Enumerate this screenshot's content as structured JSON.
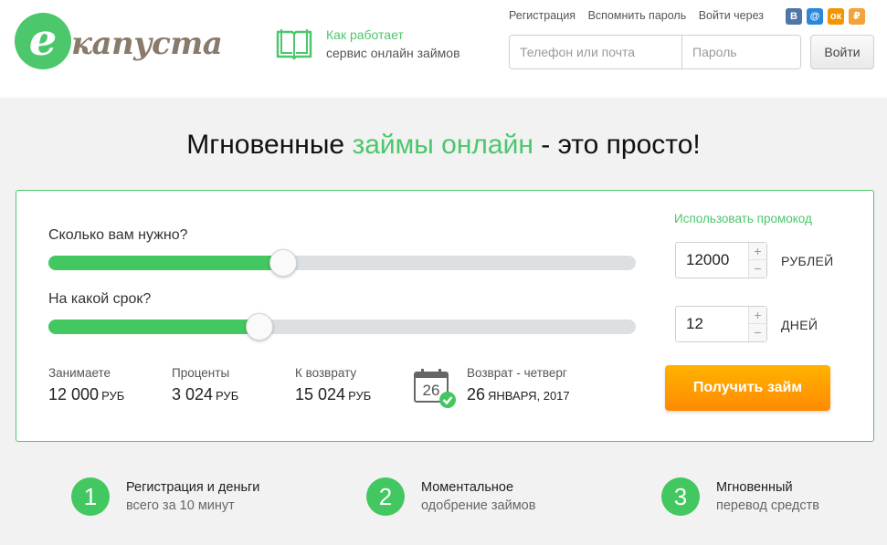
{
  "header": {
    "logo_letter": "e",
    "logo_text": "капуста",
    "how_line1": "Как работает",
    "how_line2": "сервис онлайн займов",
    "links": {
      "register": "Регистрация",
      "recover": "Вспомнить пароль",
      "login_via": "Войти через"
    },
    "social": [
      {
        "name": "vk-icon",
        "glyph": "В",
        "color": "#4f76a6"
      },
      {
        "name": "mailru-icon",
        "glyph": "@",
        "color": "#2b88d8"
      },
      {
        "name": "odnoklassniki-icon",
        "glyph": "ок",
        "color": "#f29500"
      },
      {
        "name": "yandex-money-icon",
        "glyph": "₽",
        "color": "#f2a33a"
      }
    ],
    "phone_placeholder": "Телефон или почта",
    "password_placeholder": "Пароль",
    "login_button": "Войти"
  },
  "headline": {
    "part1": "Мгновенные ",
    "part2": "займы онлайн",
    "part3": " - это просто!"
  },
  "calculator": {
    "promo": "Использовать промокод",
    "amount_question": "Сколько вам нужно?",
    "term_question": "На какой срок?",
    "amount_value": "12000",
    "amount_unit": "РУБЛЕЙ",
    "term_value": "12",
    "term_unit": "ДНЕЙ",
    "amount_slider_fraction": 0.4,
    "term_slider_fraction": 0.36,
    "borrow_label": "Занимаете",
    "borrow_value": "12 000",
    "interest_label": "Проценты",
    "interest_value": "3 024",
    "return_label": "К возврату",
    "return_value": "15 024",
    "currency": "РУБ",
    "return_day_label": "Возврат - четверг",
    "return_date_day": "26",
    "return_date_rest": "ЯНВАРЯ, 2017",
    "calendar_day": "26",
    "get_loan_button": "Получить займ",
    "colors": {
      "accent": "#4cc76b",
      "button": "#ff9a00"
    }
  },
  "steps": [
    {
      "num": "1",
      "line1": "Регистрация и деньги",
      "line2": "всего за 10 минут"
    },
    {
      "num": "2",
      "line1": "Моментальное",
      "line2": "одобрение займов"
    },
    {
      "num": "3",
      "line1": "Мгновенный",
      "line2": "перевод средств"
    }
  ]
}
